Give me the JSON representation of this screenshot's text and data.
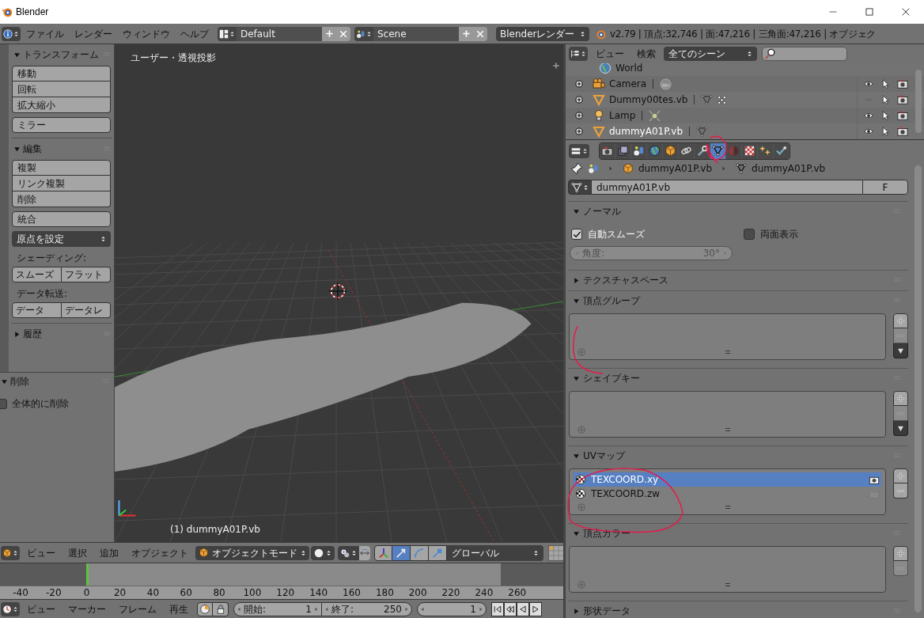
{
  "window": {
    "title": "Blender"
  },
  "menu_bar": {
    "menus": [
      "ファイル",
      "レンダー",
      "ウィンドウ",
      "ヘルプ"
    ],
    "layout": "Default",
    "scene": "Scene",
    "engine": "Blenderレンダー",
    "stats": "v2.79 | 頂点:32,746 | 面:47,216 | 三角面:47,216 | オブジェク"
  },
  "tool_shelf": {
    "panels": [
      {
        "title": "トランスフォーム",
        "expanded": true,
        "items": [
          {
            "kind": "group",
            "labels": [
              "移動",
              "回転",
              "拡大縮小"
            ]
          },
          {
            "kind": "group",
            "labels": [
              "ミラー"
            ]
          }
        ]
      },
      {
        "title": "編集",
        "expanded": true,
        "items": [
          {
            "kind": "group",
            "labels": [
              "複製",
              "リンク複製",
              "削除"
            ]
          },
          {
            "kind": "group",
            "labels": [
              "統合"
            ]
          },
          {
            "kind": "dropdown",
            "label": "原点を設定"
          },
          {
            "kind": "label",
            "label": "シェーディング:"
          },
          {
            "kind": "row",
            "labels": [
              "スムーズ",
              "フラット"
            ]
          },
          {
            "kind": "label",
            "label": "データ転送:"
          },
          {
            "kind": "row",
            "labels": [
              "データ",
              "データレ"
            ]
          }
        ]
      },
      {
        "title": "履歴",
        "expanded": false
      }
    ],
    "operator": {
      "title": "削除",
      "expanded": true,
      "option": {
        "label": "全体的に削除",
        "checked": false
      }
    }
  },
  "viewport": {
    "view_label": "ユーザー・透視投影",
    "object_label": "(1) dummyA01P.vb"
  },
  "view3d_header": {
    "menus": [
      "ビュー",
      "選択",
      "追加",
      "オブジェクト"
    ],
    "mode": "オブジェクトモード",
    "manipulators": [
      {
        "kind": "axes",
        "selected": false
      },
      {
        "kind": "translate",
        "selected": true
      },
      {
        "kind": "rotate",
        "selected": false
      },
      {
        "kind": "scale",
        "selected": false
      }
    ],
    "orientation": "グローバル"
  },
  "timeline": {
    "ticks": [
      "-40",
      "-20",
      "0",
      "20",
      "40",
      "60",
      "80",
      "100",
      "120",
      "140",
      "160",
      "180",
      "200",
      "220",
      "240",
      "260"
    ]
  },
  "timeline_header": {
    "menus": [
      "ビュー",
      "マーカー",
      "フレーム",
      "再生"
    ],
    "start_label": "開始:",
    "start": "1",
    "end_label": "終了:",
    "end": "250",
    "current": "1"
  },
  "outliner": {
    "menus": [
      "ビュー",
      "検索"
    ],
    "display": "全てのシーン",
    "rows": [
      {
        "kind": "world",
        "name": "World",
        "visible": null
      },
      {
        "kind": "camera",
        "name": "Camera",
        "visible": true,
        "data_icons": [
          {
            "kind": "camera_data"
          }
        ]
      },
      {
        "kind": "mesh",
        "name": "Dummy00tes.vb",
        "visible": false,
        "data_icons": [
          {
            "kind": "mesh_data"
          },
          {
            "kind": "dots"
          }
        ]
      },
      {
        "kind": "lamp",
        "name": "Lamp",
        "visible": true,
        "data_icons": [
          {
            "kind": "lamp_data"
          }
        ]
      },
      {
        "kind": "mesh",
        "name": "dummyA01P.vb",
        "visible": true,
        "data_icons": [
          {
            "kind": "mesh_data"
          }
        ]
      }
    ]
  },
  "properties": {
    "tabs": [
      {
        "kind": "render",
        "selected": false
      },
      {
        "kind": "layers",
        "selected": false
      },
      {
        "kind": "scene",
        "selected": false
      },
      {
        "kind": "world",
        "selected": false
      },
      {
        "kind": "object",
        "selected": false
      },
      {
        "kind": "constraints",
        "selected": false
      },
      {
        "kind": "modifiers",
        "selected": false
      },
      {
        "kind": "data",
        "selected": true
      },
      {
        "kind": "material",
        "selected": false
      },
      {
        "kind": "texture",
        "selected": false
      },
      {
        "kind": "particles",
        "selected": false
      },
      {
        "kind": "physics",
        "selected": false
      }
    ],
    "breadcrumb": [
      {
        "kind": "object",
        "label": "dummyA01P.vb"
      },
      {
        "kind": "data",
        "label": "dummyA01P.vb"
      }
    ],
    "datablock": {
      "name": "dummyA01P.vb",
      "fake_user": "F"
    },
    "panels": [
      {
        "kind": "normals",
        "title": "ノーマル",
        "expanded": true,
        "auto_smooth": {
          "label": "自動スムーズ",
          "checked": true
        },
        "double_sided": {
          "label": "両面表示",
          "checked": false
        },
        "angle": {
          "label": "角度:",
          "value": "30°",
          "disabled": true
        }
      },
      {
        "kind": "plain",
        "title": "テクスチャスペース",
        "expanded": false
      },
      {
        "kind": "list",
        "title": "頂点グループ",
        "expanded": true,
        "menu_button": true
      },
      {
        "kind": "list",
        "title": "シェイプキー",
        "expanded": true,
        "menu_button": true
      },
      {
        "kind": "list",
        "title": "UVマップ",
        "expanded": true,
        "items": [
          {
            "label": "TEXCOORD.xy",
            "selected": true
          },
          {
            "label": "TEXCOORD.zw",
            "selected": false
          }
        ],
        "menu_button": false
      },
      {
        "kind": "list",
        "title": "頂点カラー",
        "expanded": true,
        "menu_button": false
      },
      {
        "kind": "plain",
        "title": "形状データ",
        "expanded": false
      }
    ]
  }
}
